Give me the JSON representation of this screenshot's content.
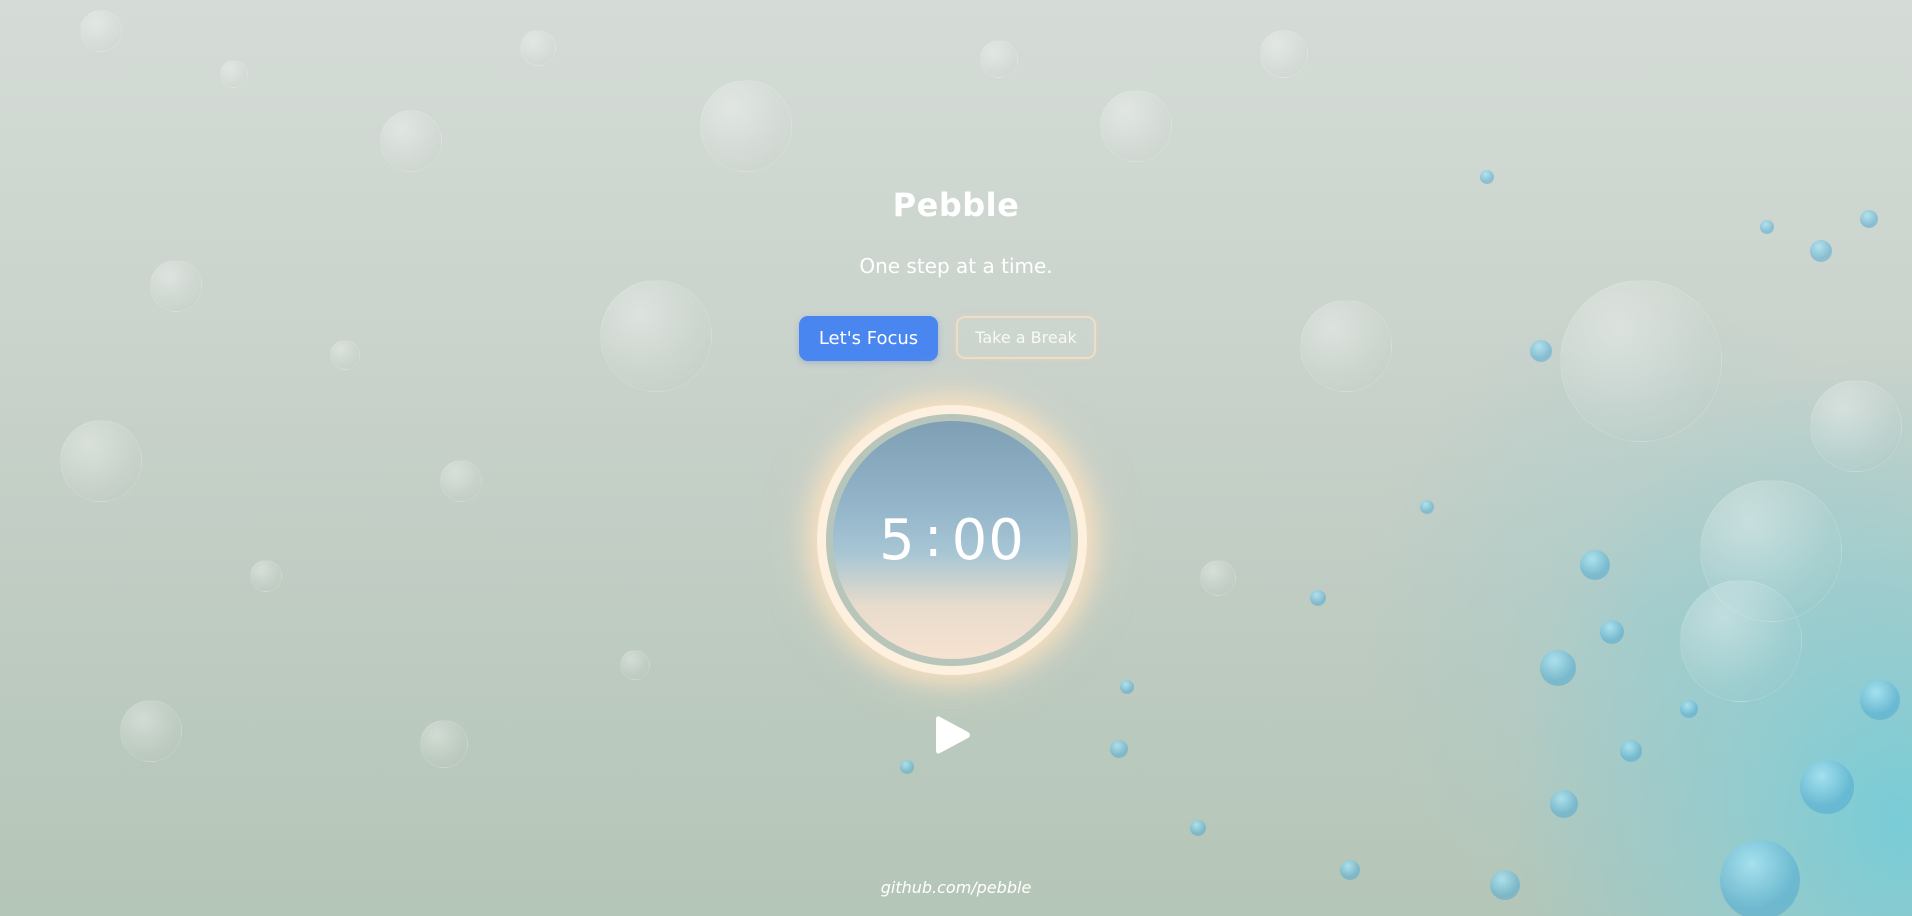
{
  "app": {
    "title": "Pebble",
    "tagline": "One step at a time."
  },
  "modes": {
    "focus_label": "Let's Focus",
    "break_label": "Take a Break",
    "active": "focus"
  },
  "timer": {
    "minutes": "5",
    "separator": ":",
    "seconds": "00"
  },
  "controls": {
    "play_icon": "play-icon"
  },
  "footer": {
    "link_text": "github.com/pebble"
  },
  "colors": {
    "accent": "#4a86f0",
    "break_border": "#ffe1be",
    "timer_glow": "#fde6cc"
  }
}
